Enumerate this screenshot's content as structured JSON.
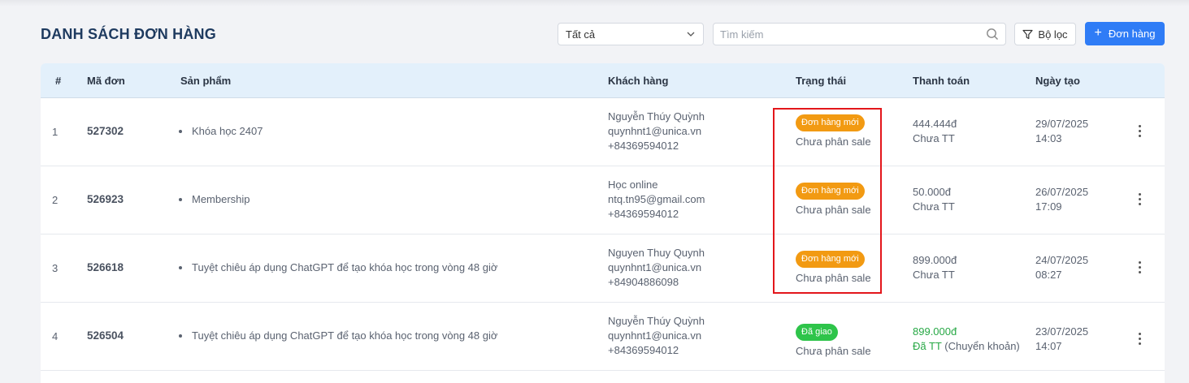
{
  "page": {
    "title": "DANH SÁCH ĐƠN HÀNG"
  },
  "toolbar": {
    "status_filter": {
      "selected": "Tất cả",
      "icon": "chevron-down-icon"
    },
    "search": {
      "placeholder": "Tìm kiếm",
      "value": "",
      "icon": "search-icon"
    },
    "filter_label": "Bộ lọc",
    "add_label": "Đơn hàng",
    "add_icon_glyph": "+"
  },
  "table": {
    "columns": [
      "#",
      "Mã đơn",
      "Sản phẩm",
      "Khách hàng",
      "Trạng thái",
      "Thanh toán",
      "Ngày tạo"
    ],
    "rows": [
      {
        "index": "1",
        "code": "527302",
        "product": "Khóa học 2407",
        "customer_name": "Nguyễn Thúy Quỳnh",
        "customer_email": "quynhnt1@unica.vn",
        "customer_phone": "+84369594012",
        "status": "Đơn hàng mới",
        "status_color": "#f29a12",
        "sale_status": "Chưa phân sale",
        "amount": "444.444đ",
        "payment_status": "Chưa TT",
        "payment_method": "",
        "date": "29/07/2025",
        "time": "14:03"
      },
      {
        "index": "2",
        "code": "526923",
        "product": "Membership",
        "customer_name": "Học online",
        "customer_email": "ntq.tn95@gmail.com",
        "customer_phone": "+84369594012",
        "status": "Đơn hàng mới",
        "status_color": "#f29a12",
        "sale_status": "Chưa phân sale",
        "amount": "50.000đ",
        "payment_status": "Chưa TT",
        "payment_method": "",
        "date": "26/07/2025",
        "time": "17:09"
      },
      {
        "index": "3",
        "code": "526618",
        "product": "Tuyệt chiêu áp dụng ChatGPT để tạo khóa học trong vòng 48 giờ",
        "customer_name": "Nguyen Thuy Quynh",
        "customer_email": "quynhnt1@unica.vn",
        "customer_phone": "+84904886098",
        "status": "Đơn hàng mới",
        "status_color": "#f29a12",
        "sale_status": "Chưa phân sale",
        "amount": "899.000đ",
        "payment_status": "Chưa TT",
        "payment_method": "",
        "date": "24/07/2025",
        "time": "08:27"
      },
      {
        "index": "4",
        "code": "526504",
        "product": "Tuyệt chiêu áp dụng ChatGPT để tạo khóa học trong vòng 48 giờ",
        "customer_name": "Nguyễn Thúy Quỳnh",
        "customer_email": "quynhnt1@unica.vn",
        "customer_phone": "+84369594012",
        "status": "Đã giao",
        "status_color": "#2ec44a",
        "sale_status": "Chưa phân sale",
        "amount": "899.000đ",
        "payment_status": "Đã TT",
        "payment_method": " (Chuyển khoản)",
        "date": "23/07/2025",
        "time": "14:07"
      }
    ]
  },
  "colors": {
    "accent": "#2f7cf6",
    "title": "#1e3a5f",
    "header_bg": "#e3f0fb",
    "highlight": "#e3161b",
    "paid": "#27a845"
  }
}
